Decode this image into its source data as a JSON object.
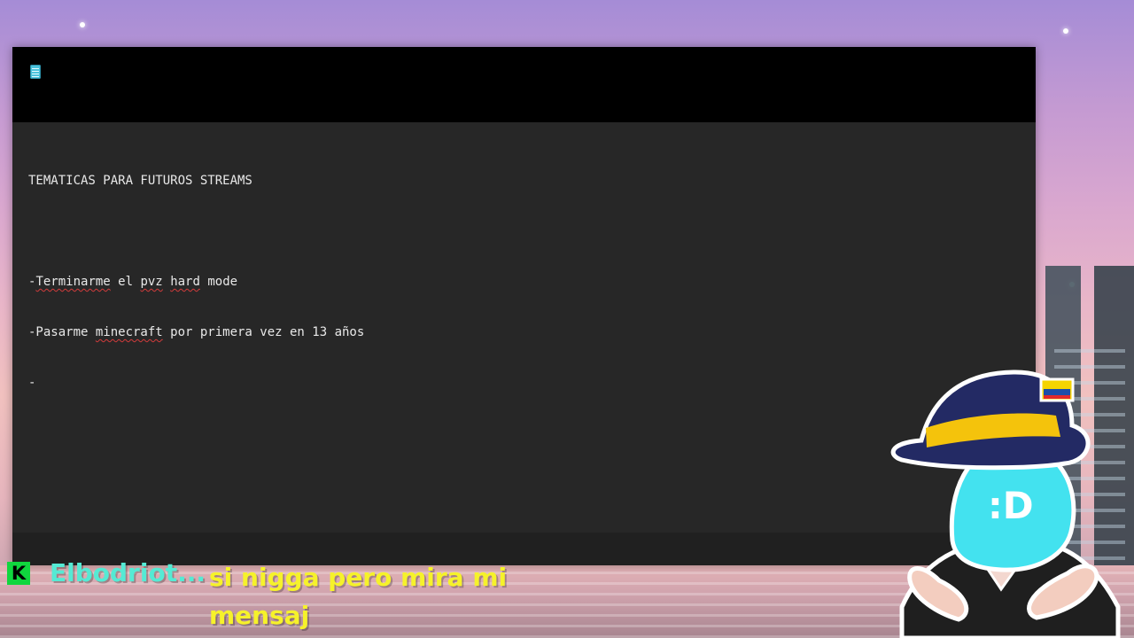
{
  "window": {
    "icon": "notepad-icon"
  },
  "editor": {
    "lines": [
      "TEMATICAS PARA FUTUROS STREAMS",
      "",
      "-Terminarme el pvz hard mode",
      "-Pasarme minecraft por primera vez en 13 años",
      "-"
    ],
    "misspelled_words": [
      "Terminarme",
      "pvz",
      "hard",
      "minecraft"
    ]
  },
  "chat": {
    "platform_badge": "K",
    "username": "Elbodriot...",
    "message": "si nigga pero mira mi mensaj"
  },
  "avatar": {
    "face_text": ":D"
  },
  "colors": {
    "window_bg": "#272727",
    "title_bar": "#000000",
    "chat_username": "#55ead4",
    "chat_message": "#f6f22a",
    "badge_green": "#10d63e"
  }
}
